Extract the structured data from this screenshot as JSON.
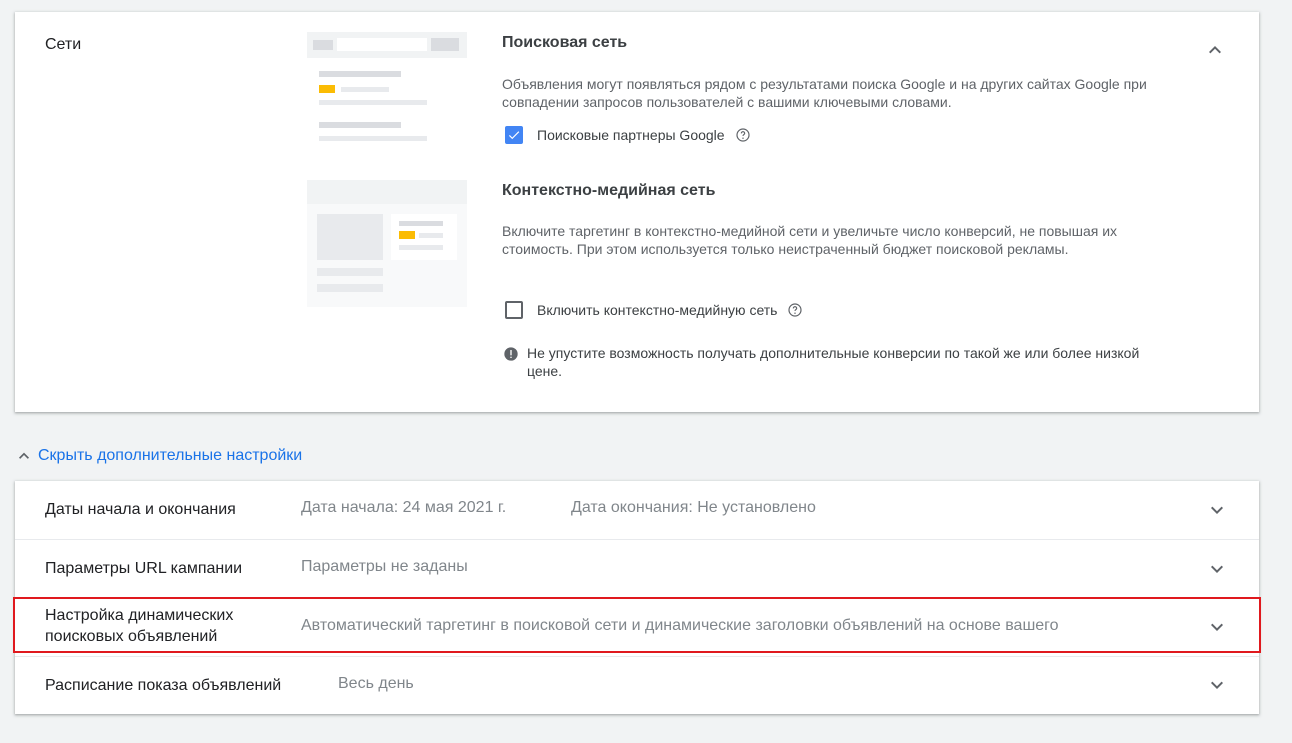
{
  "networks": {
    "section_label": "Сети",
    "search": {
      "title": "Поисковая сеть",
      "description": "Объявления могут появляться рядом с результатами поиска Google и на других сайтах Google при совпадении запросов пользователей с вашими ключевыми словами.",
      "partners_label": "Поисковые партнеры Google",
      "partners_checked": true
    },
    "display": {
      "title": "Контекстно-медийная сеть",
      "description": "Включите таргетинг в контекстно-медийной сети и увеличьте число конверсий, не повышая их стоимость. При этом используется только неистраченный бюджет поисковой рекламы.",
      "enable_label": "Включить контекстно-медийную сеть",
      "enable_checked": false,
      "notice": "Не упустите возможность получать дополнительные конверсии по такой же или более низкой цене."
    }
  },
  "hide_settings_link": "Скрыть дополнительные настройки",
  "settings": {
    "dates": {
      "label": "Даты начала и окончания",
      "start": "Дата начала: 24 мая 2021 г.",
      "end": "Дата окончания: Не установлено"
    },
    "url_params": {
      "label": "Параметры URL кампании",
      "value": "Параметры не заданы"
    },
    "dsa": {
      "label_line1": "Настройка динамических",
      "label_line2": "поисковых объявлений",
      "value": "Автоматический таргетинг в поисковой сети и динамические заголовки объявлений на основе вашего"
    },
    "schedule": {
      "label": "Расписание показа объявлений",
      "value": "Весь день"
    }
  },
  "colors": {
    "accent": "#1a73e8",
    "checkbox_checked": "#4285f4",
    "highlight": "#e0191e",
    "illustration_yellow": "#fbbc04"
  }
}
